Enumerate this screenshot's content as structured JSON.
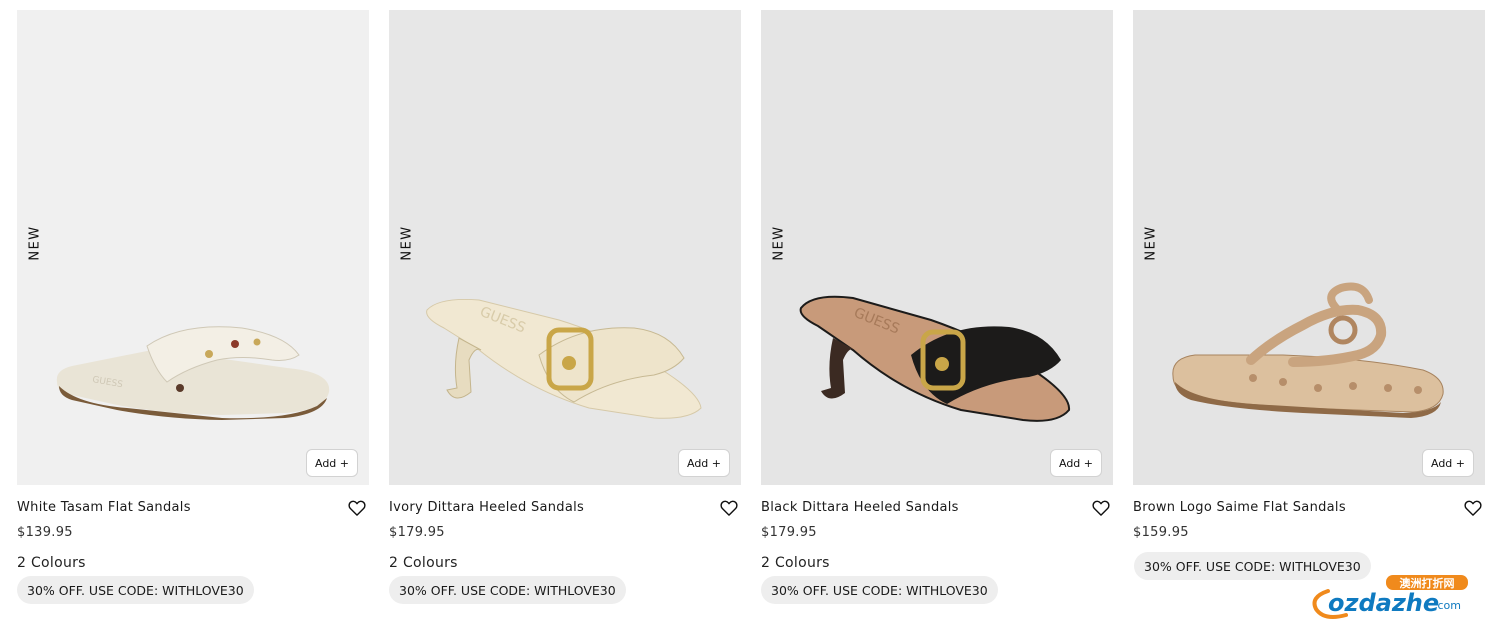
{
  "products": [
    {
      "badge": "NEW",
      "name": "White Tasam Flat Sandals",
      "price": "$139.95",
      "colours": "2 Colours",
      "promo": "30% OFF. USE CODE: WITHLOVE30",
      "add_label": "Add +",
      "bg_color": "#f0f0f0",
      "shoe_color": "#efebe0"
    },
    {
      "badge": "NEW",
      "name": "Ivory Dittara Heeled Sandals",
      "price": "$179.95",
      "colours": "2 Colours",
      "promo": "30% OFF. USE CODE: WITHLOVE30",
      "add_label": "Add +",
      "bg_color": "#e7e7e7",
      "shoe_color": "#eee4cb"
    },
    {
      "badge": "NEW",
      "name": "Black Dittara Heeled Sandals",
      "price": "$179.95",
      "colours": "2 Colours",
      "promo": "30% OFF. USE CODE: WITHLOVE30",
      "add_label": "Add +",
      "bg_color": "#e5e5e5",
      "shoe_color": "#1c1b1a"
    },
    {
      "badge": "NEW",
      "name": "Brown Logo Saime Flat Sandals",
      "price": "$159.95",
      "colours": "",
      "promo": "30% OFF. USE CODE: WITHLOVE30",
      "add_label": "Add +",
      "bg_color": "#e4e4e4",
      "shoe_color": "#d7b796"
    }
  ],
  "watermark": {
    "chinese_text": "澳洲打折网",
    "brand": "ozdazhe",
    "suffix": ".com"
  },
  "colors": {
    "accent": "#0f7ac0",
    "watermark_orange": "#f08a1c"
  }
}
